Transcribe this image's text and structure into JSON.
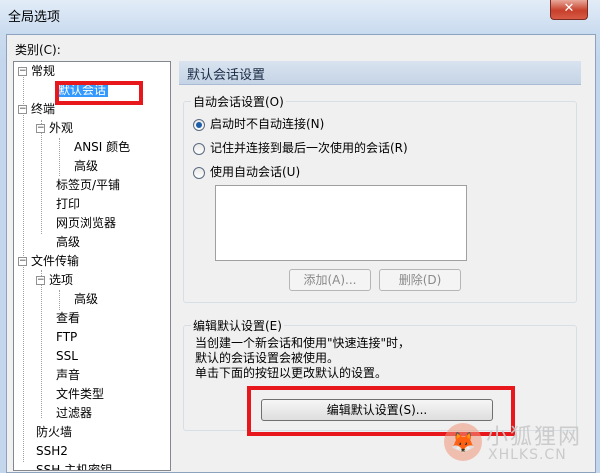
{
  "window": {
    "title": "全局选项",
    "close_glyph": "✕"
  },
  "category_label": "类别(C):",
  "tree": {
    "general": "常规",
    "default_session": "默认会话",
    "terminal": "终端",
    "appearance": "外观",
    "ansi_color": "ANSI 颜色",
    "appearance_advanced": "高级",
    "tabs_tiling": "标签页/平铺",
    "print": "打印",
    "web_browser": "网页浏览器",
    "terminal_advanced": "高级",
    "file_transfer": "文件传输",
    "options": "选项",
    "options_advanced": "高级",
    "view": "查看",
    "ftp": "FTP",
    "ssl": "SSL",
    "sound": "声音",
    "file_type": "文件类型",
    "filter": "过滤器",
    "firewall": "防火墙",
    "ssh2": "SSH2",
    "ssh_host_key": "SSH 主机密钥"
  },
  "panel": {
    "header": "默认会话设置",
    "auto_group": {
      "title": "自动会话设置(O)",
      "options": [
        {
          "label": "启动时不自动连接(N)",
          "checked": true
        },
        {
          "label": "记住并连接到最后一次使用的会话(R)",
          "checked": false
        },
        {
          "label": "使用自动会话(U)",
          "checked": false
        }
      ],
      "add_button": "添加(A)...",
      "delete_button": "删除(D)"
    },
    "edit_group": {
      "title": "编辑默认设置(E)",
      "desc_line1": "当创建一个新会话和使用\"快速连接\"时，",
      "desc_line2": "默认的会话设置会被使用。",
      "desc_line3": "单击下面的按钮以更改默认的设置。",
      "edit_button": "编辑默认设置(S)..."
    }
  },
  "watermark": {
    "brand": "小狐狸网",
    "domain": "XHLKS.CN"
  },
  "colors": {
    "highlight": "#e8171b",
    "selection": "#3399ff"
  }
}
